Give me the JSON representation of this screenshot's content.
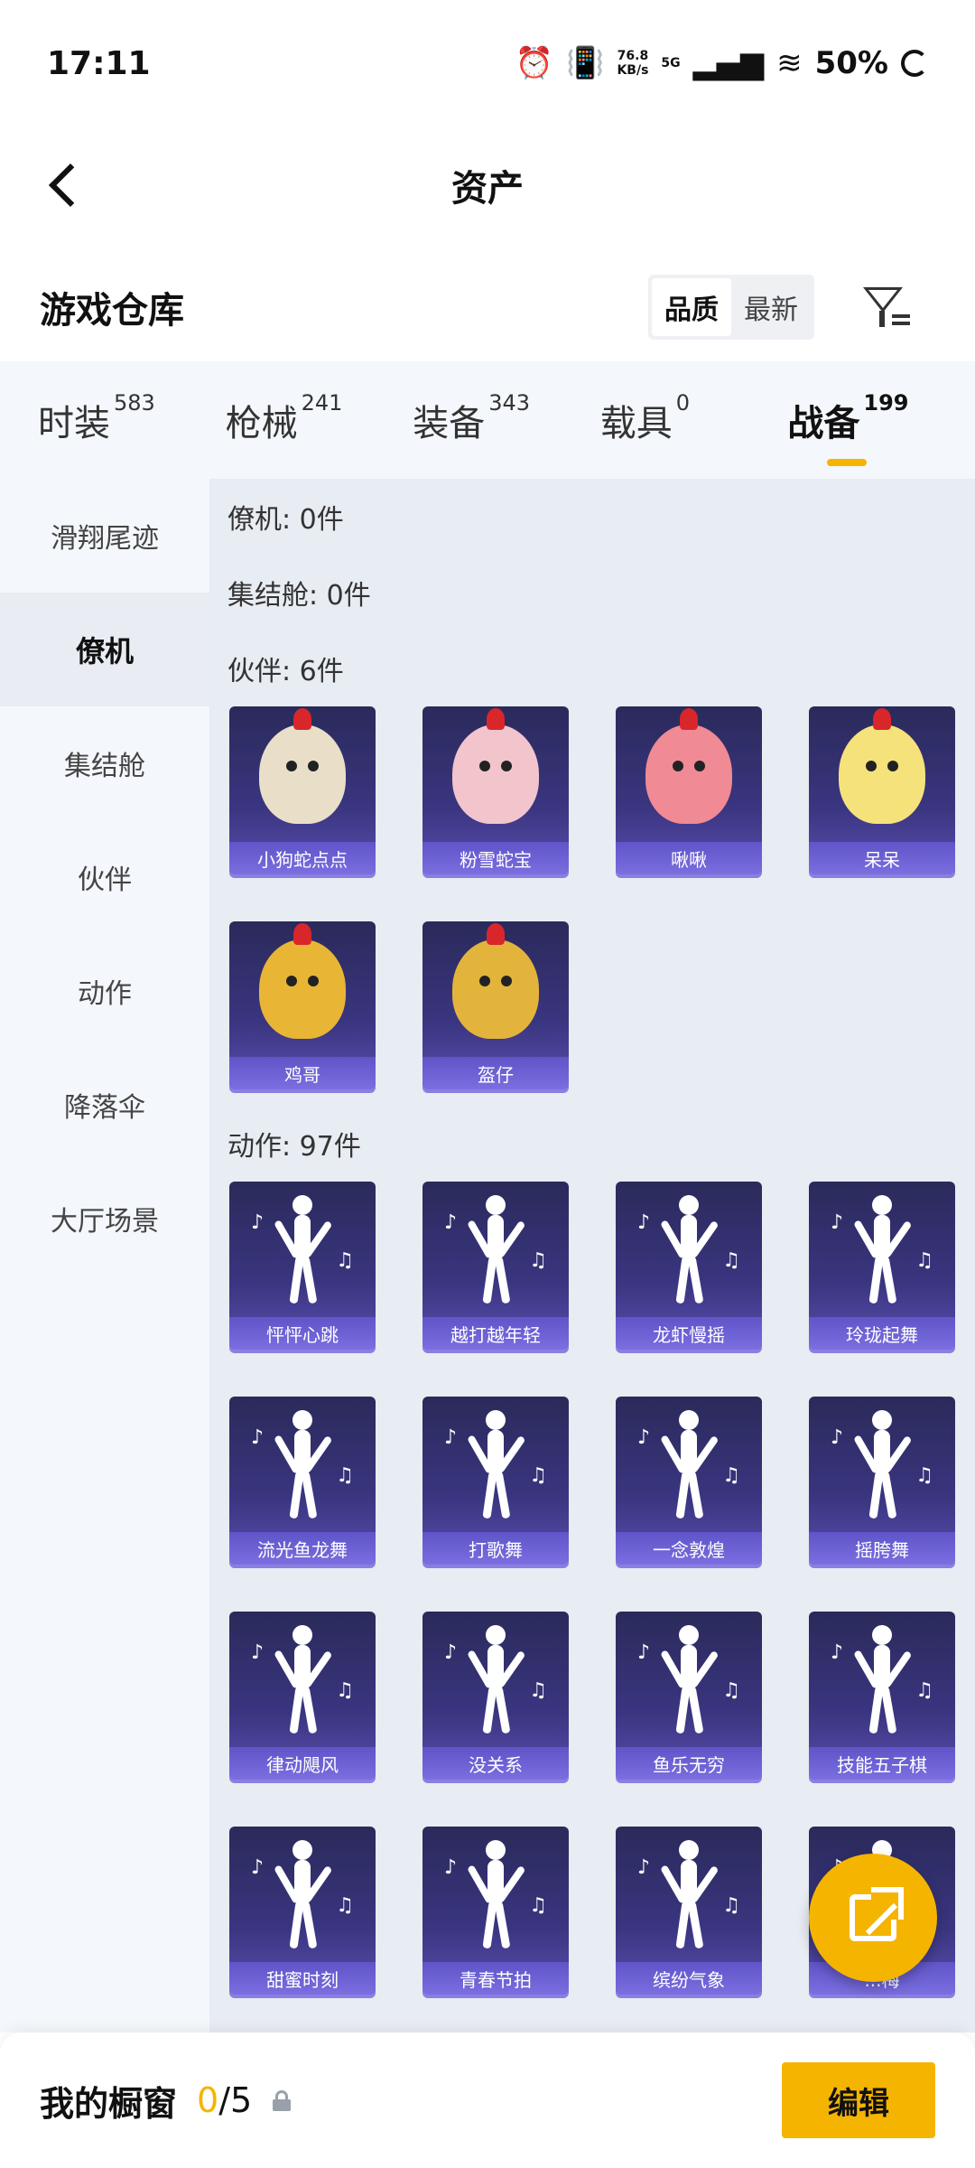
{
  "status": {
    "time": "17:11",
    "net_speed_value": "76.8",
    "net_speed_unit": "KB/s",
    "network": "5G",
    "battery": "50%"
  },
  "header": {
    "title": "资产"
  },
  "warehouse": {
    "title": "游戏仓库",
    "sort_options": [
      "品质",
      "最新"
    ],
    "sort_selected": "品质"
  },
  "categories": [
    {
      "label": "时装",
      "count": "583",
      "active": false
    },
    {
      "label": "枪械",
      "count": "241",
      "active": false
    },
    {
      "label": "装备",
      "count": "343",
      "active": false
    },
    {
      "label": "载具",
      "count": "0",
      "active": false
    },
    {
      "label": "战备",
      "count": "199",
      "active": true
    }
  ],
  "sidebar": {
    "items": [
      {
        "label": "滑翔尾迹",
        "active": false
      },
      {
        "label": "僚机",
        "active": true
      },
      {
        "label": "集结舱",
        "active": false
      },
      {
        "label": "伙伴",
        "active": false
      },
      {
        "label": "动作",
        "active": false
      },
      {
        "label": "降落伞",
        "active": false
      },
      {
        "label": "大厅场景",
        "active": false
      }
    ]
  },
  "sections": {
    "wingman": "僚机: 0件",
    "assembly": "集结舱: 0件",
    "partner": "伙伴: 6件",
    "emote": "动作: 97件"
  },
  "partners": [
    {
      "name": "小狗蛇点点",
      "color": "#e9dfc8"
    },
    {
      "name": "粉雪蛇宝",
      "color": "#f2c4cc"
    },
    {
      "name": "啾啾",
      "color": "#f08a94"
    },
    {
      "name": "呆呆",
      "color": "#f5e27a"
    },
    {
      "name": "鸡哥",
      "color": "#e8b634"
    },
    {
      "name": "盔仔",
      "color": "#e3b43c"
    }
  ],
  "emotes": [
    {
      "name": "怦怦心跳"
    },
    {
      "name": "越打越年轻"
    },
    {
      "name": "龙虾慢摇"
    },
    {
      "name": "玲珑起舞"
    },
    {
      "name": "流光鱼龙舞"
    },
    {
      "name": "打歌舞"
    },
    {
      "name": "一念敦煌"
    },
    {
      "name": "摇胯舞"
    },
    {
      "name": "律动飓风"
    },
    {
      "name": "没关系"
    },
    {
      "name": "鱼乐无穷"
    },
    {
      "name": "技能五子棋"
    },
    {
      "name": "甜蜜时刻"
    },
    {
      "name": "青春节拍"
    },
    {
      "name": "缤纷气象"
    },
    {
      "name": "...梅"
    }
  ],
  "bottom": {
    "label": "我的橱窗",
    "current": "0",
    "total": "/5",
    "edit_label": "编辑"
  }
}
